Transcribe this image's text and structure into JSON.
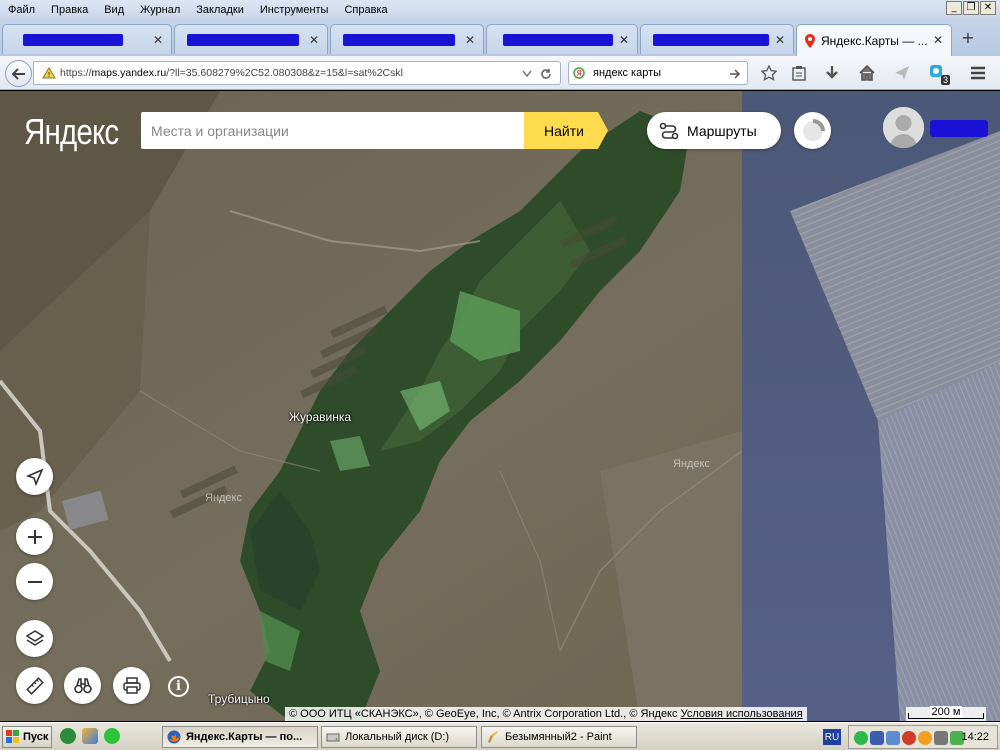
{
  "menubar": {
    "items": [
      "Файл",
      "Правка",
      "Вид",
      "Журнал",
      "Закладки",
      "Инструменты",
      "Справка"
    ],
    "win_min": "_",
    "win_restore": "❐",
    "win_close": "✕"
  },
  "tabs": {
    "active_title": "Яндекс.Карты — ...",
    "close_glyph": "✕",
    "newtab_glyph": "+"
  },
  "navbar": {
    "url_prefix": "https://",
    "url_host": "maps.yandex.ru",
    "url_rest": "/?ll=35.608279%2C52.080308&z=15&l=sat%2Cskl",
    "search_text": "яндекс карты",
    "addon_badge": "3"
  },
  "yandex": {
    "logo": "Яндекс",
    "search_placeholder": "Места и организации",
    "find_label": "Найти",
    "routes_label": "Маршруты"
  },
  "map": {
    "label_village1": "Журавинка",
    "label_village2": "Трубицыно",
    "watermark": "Яндекс",
    "info_glyph": "i",
    "copyright": "© ООО ИТЦ «СКАНЭКС», © GeoEye, Inc, © Antrix Corporation Ltd., © Яндекс",
    "terms_link": "Условия использования",
    "scale_label": "200 м"
  },
  "taskbar": {
    "start_label": "Пуск",
    "tasks": [
      "Яндекс.Карты — по...",
      "Локальный диск (D:)",
      "Безымянный2 - Paint"
    ],
    "lang": "RU",
    "clock": "14:22"
  },
  "colors": {
    "yandex_yellow": "#ffdb4d",
    "redacted_blue": "#1a12d6"
  }
}
